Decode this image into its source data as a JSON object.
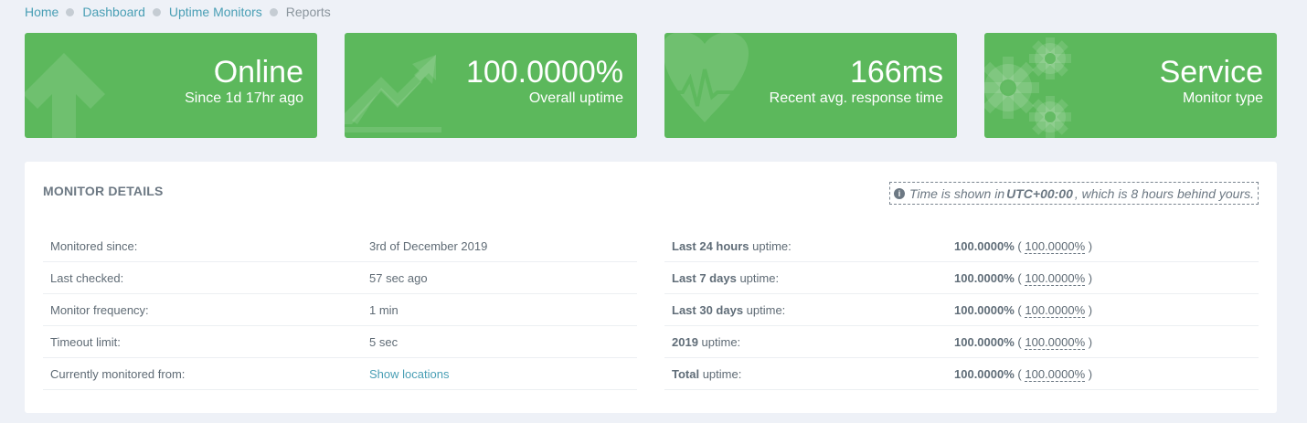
{
  "breadcrumb": [
    {
      "label": "Home",
      "current": false
    },
    {
      "label": "Dashboard",
      "current": false
    },
    {
      "label": "Uptime Monitors",
      "current": false
    },
    {
      "label": "Reports",
      "current": true
    }
  ],
  "cards": [
    {
      "value": "Online",
      "label": "Since 1d 17hr ago",
      "icon": "arrow-up-icon"
    },
    {
      "value": "100.0000%",
      "label": "Overall uptime",
      "icon": "trending-up-icon"
    },
    {
      "value": "166ms",
      "label": "Recent avg. response time",
      "icon": "heartbeat-icon"
    },
    {
      "value": "Service",
      "label": "Monitor type",
      "icon": "gears-icon"
    }
  ],
  "colors": {
    "card_green": "#5cb85c",
    "link": "#4a9fb5",
    "background": "#eef1f7"
  },
  "details": {
    "title": "MONITOR DETAILS",
    "tz_note": {
      "prefix": "Time is shown in",
      "tz": "UTC+00:00",
      "suffix": ", which is 8 hours behind yours."
    },
    "left_rows": [
      {
        "key": "Monitored since:",
        "value": "3rd of December 2019"
      },
      {
        "key": "Last checked:",
        "value": "57 sec ago"
      },
      {
        "key": "Monitor frequency:",
        "value": "1 min"
      },
      {
        "key": "Timeout limit:",
        "value": "5 sec"
      },
      {
        "key": "Currently monitored from:",
        "value": "Show locations"
      }
    ],
    "right_rows": [
      {
        "period": "Last 24 hours",
        "suffix": " uptime:",
        "value": "100.0000%",
        "paren_value": "100.0000%"
      },
      {
        "period": "Last 7 days",
        "suffix": " uptime:",
        "value": "100.0000%",
        "paren_value": "100.0000%"
      },
      {
        "period": "Last 30 days",
        "suffix": " uptime:",
        "value": "100.0000%",
        "paren_value": "100.0000%"
      },
      {
        "period": "2019",
        "suffix": " uptime:",
        "value": "100.0000%",
        "paren_value": "100.0000%"
      },
      {
        "period": "Total",
        "suffix": " uptime:",
        "value": "100.0000%",
        "paren_value": "100.0000%"
      }
    ],
    "paren_open": "(",
    "paren_close": ")"
  }
}
